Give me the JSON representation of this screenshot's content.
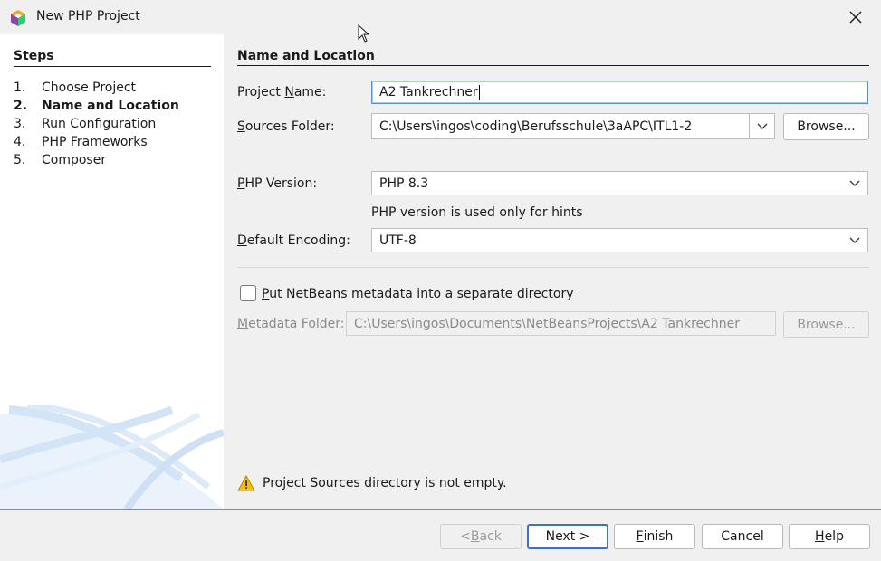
{
  "window": {
    "title": "New PHP Project",
    "app_icon": "netbeans-cube-icon",
    "close_icon": "close-icon"
  },
  "steps": {
    "heading": "Steps",
    "items": [
      {
        "num": "1.",
        "label": "Choose Project",
        "current": false
      },
      {
        "num": "2.",
        "label": "Name and Location",
        "current": true
      },
      {
        "num": "3.",
        "label": "Run Configuration",
        "current": false
      },
      {
        "num": "4.",
        "label": "PHP Frameworks",
        "current": false
      },
      {
        "num": "5.",
        "label": "Composer",
        "current": false
      }
    ]
  },
  "form": {
    "heading": "Name and Location",
    "project_name": {
      "label_pre": "Project ",
      "label_mnemonic": "N",
      "label_post": "ame:",
      "value": "A2 Tankrechner"
    },
    "sources_folder": {
      "label_pre": "",
      "label_mnemonic": "S",
      "label_post": "ources Folder:",
      "value": "C:\\Users\\ingos\\coding\\Berufsschule\\3aAPC\\ITL1-2",
      "browse": "Browse..."
    },
    "php_version": {
      "label_pre": "",
      "label_mnemonic": "P",
      "label_post": "HP Version:",
      "value": "PHP 8.3",
      "hint": "PHP version is used only for hints"
    },
    "encoding": {
      "label_pre": "",
      "label_mnemonic": "D",
      "label_post": "efault Encoding:",
      "value": "UTF-8"
    },
    "metadata_checkbox": {
      "label_pre": "",
      "label_mnemonic": "P",
      "label_post": "ut NetBeans metadata into a separate directory",
      "checked": false
    },
    "metadata_folder": {
      "label_pre": "",
      "label_mnemonic": "M",
      "label_post": "etadata Folder:",
      "value": "C:\\Users\\ingos\\Documents\\NetBeansProjects\\A2 Tankrechner",
      "browse": "Browse..."
    },
    "warning": "Project Sources directory is not empty."
  },
  "buttons": {
    "back": {
      "pre": "< ",
      "mnemonic": "B",
      "post": "ack"
    },
    "next": {
      "label": "Next >"
    },
    "finish": {
      "pre": "",
      "mnemonic": "F",
      "post": "inish"
    },
    "cancel": {
      "label": "Cancel"
    },
    "help": {
      "pre": "",
      "mnemonic": "H",
      "post": "elp"
    }
  },
  "colors": {
    "accent": "#3a72c4",
    "warning_icon": "#e0b400"
  }
}
